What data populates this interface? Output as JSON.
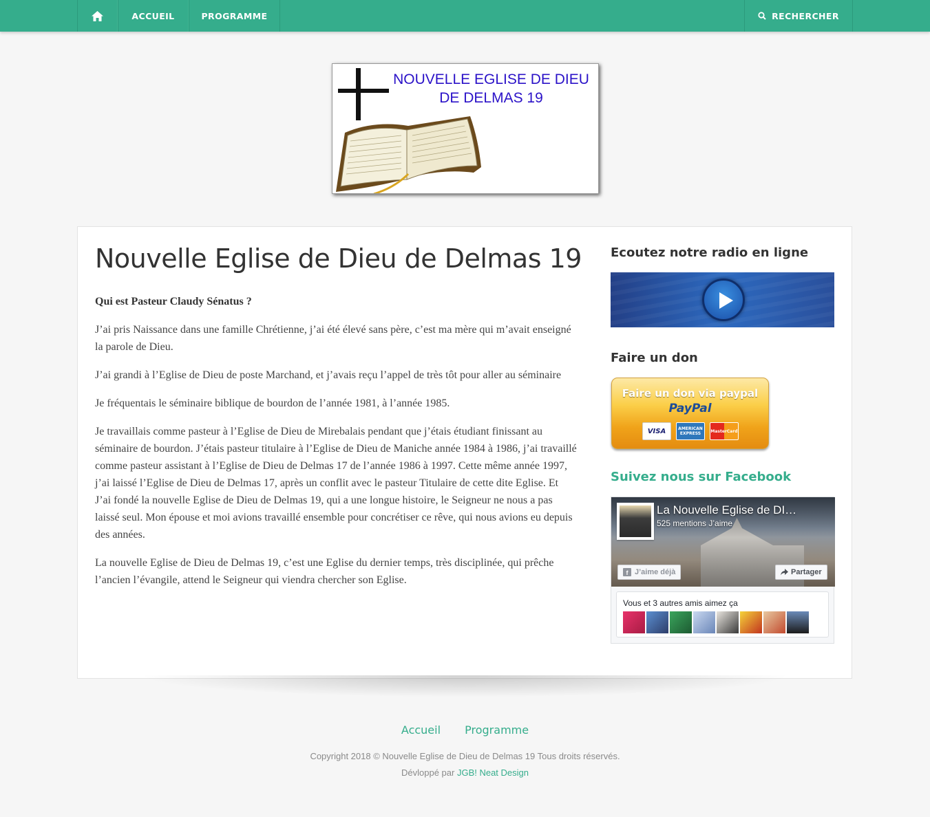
{
  "nav": {
    "home_icon": "home-icon",
    "items": [
      {
        "label": "ACCUEIL"
      },
      {
        "label": "PROGRAMME"
      }
    ],
    "search_label": "RECHERCHER",
    "search_icon": "search-icon"
  },
  "logo": {
    "line1": "NOUVELLE EGLISE DE DIEU",
    "line2": "DE DELMAS 19"
  },
  "article": {
    "title": "Nouvelle Eglise de Dieu de Delmas 19",
    "lead": "Qui est Pasteur Claudy Sénatus ?",
    "paragraphs": [
      "J’ai pris Naissance dans une famille Chrétienne, j’ai été élevé sans père, c’est ma mère qui m’avait enseigné la parole de Dieu.",
      "J’ai grandi à l’Eglise de Dieu de poste Marchand, et j’avais reçu l’appel de très tôt pour aller au séminaire",
      "Je fréquentais le séminaire biblique de bourdon de l’année 1981, à l’année 1985.",
      "Je travaillais comme pasteur à l’Eglise de Dieu de Mirebalais pendant que j’étais étudiant finissant au séminaire de bourdon. J’étais pasteur titulaire à l’Eglise de Dieu de Maniche année 1984 à 1986, j’ai travaillé comme pasteur assistant à l’Eglise de Dieu de Delmas 17 de l’année 1986 à 1997. Cette même année 1997, j’ai laissé l’Eglise de Dieu de Delmas 17, après un conflit avec le pasteur Titulaire de cette dite Eglise. Et J’ai fondé la nouvelle Eglise de Dieu de Delmas 19, qui a une longue histoire, le Seigneur ne nous a pas laissé seul. Mon épouse et moi avions travaillé ensemble pour concrétiser ce rêve, qui nous avions eu depuis des années.",
      "La nouvelle Eglise de Dieu de Delmas 19, c’est une Eglise du dernier temps, très disciplinée, qui prêche l’ancien l’évangile, attend le Seigneur qui viendra chercher son Eglise."
    ]
  },
  "sidebar": {
    "radio_heading": "Ecoutez notre radio en ligne",
    "donate_heading": "Faire un don",
    "paypal_text": "Faire un don via paypal",
    "paypal_brand": "PayPal",
    "cards": [
      "VISA",
      "AMERICAN EXPRESS",
      "MasterCard"
    ],
    "facebook_heading": "Suivez nous sur Facebook",
    "fb_page_name": "La Nouvelle Eglise de DI…",
    "fb_likes": "525 mentions J’aime",
    "fb_like_button": "J’aime déjà",
    "fb_share_button": "Partager",
    "fb_friends_text": "Vous et 3 autres amis aimez ça"
  },
  "footer": {
    "links": [
      "Accueil",
      "Programme"
    ],
    "copyright": "Copyright 2018 © Nouvelle Eglise de Dieu de Delmas 19 Tous droits réservés.",
    "credit_prefix": "Dévloppé par ",
    "credit_link": "JGB! Neat Design"
  },
  "colors": {
    "accent": "#35ad8c",
    "logo_text": "#2b12c8"
  }
}
